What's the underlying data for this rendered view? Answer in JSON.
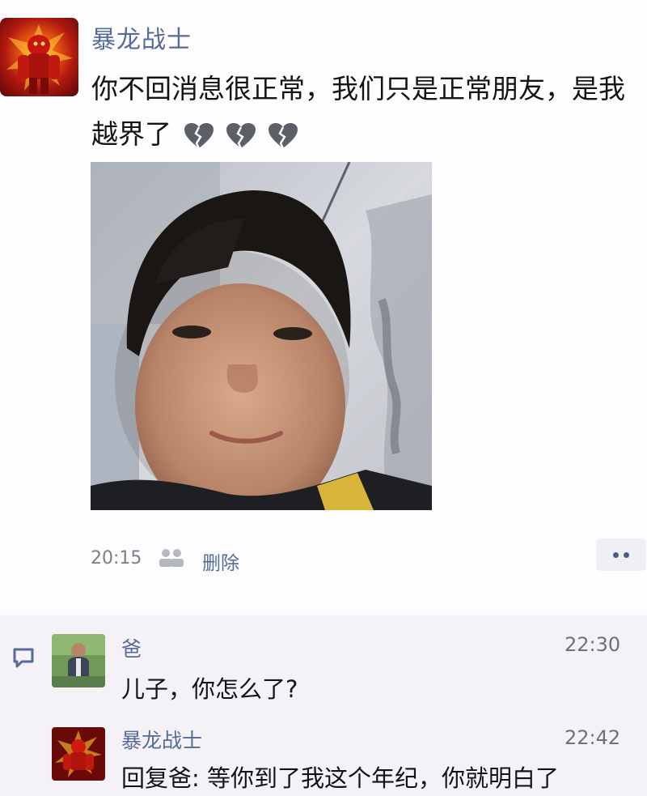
{
  "post": {
    "author": "暴龙战士",
    "text": "你不回消息很正常，我们只是正常朋友，是我越界了",
    "hearts": [
      "broken-heart-icon",
      "broken-heart-icon",
      "broken-heart-icon"
    ],
    "time": "20:15",
    "delete_label": "删除"
  },
  "comments": [
    {
      "author": "爸",
      "time": "22:30",
      "text": "儿子，你怎么了?"
    },
    {
      "author": "暴龙战士",
      "time": "22:42",
      "reply_prefix": "回复爸:",
      "text": " 等你到了我这个年纪，你就明白了"
    }
  ],
  "colors": {
    "name": "#566b95",
    "comment_bg": "#f4f2f7",
    "heart": "#5b5f66"
  }
}
